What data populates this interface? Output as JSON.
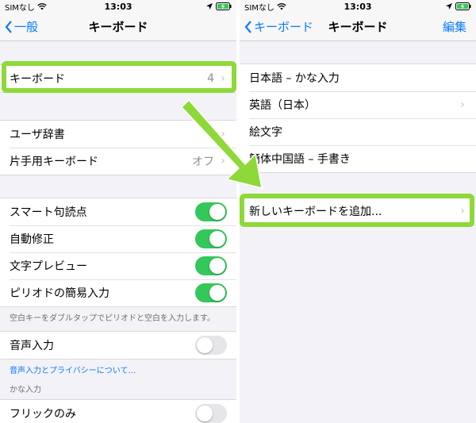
{
  "left": {
    "status": {
      "carrier": "SIMなし",
      "time": "13:03"
    },
    "nav": {
      "back_label": "一般",
      "title": "キーボード"
    },
    "keyboards_row": {
      "label": "キーボード",
      "value": "4"
    },
    "group2": [
      {
        "label": "ユーザ辞書",
        "value": ""
      },
      {
        "label": "片手用キーボード",
        "value": "オフ"
      }
    ],
    "toggles": [
      {
        "label": "スマート句読点",
        "on": true
      },
      {
        "label": "自動修正",
        "on": true
      },
      {
        "label": "文字プレビュー",
        "on": true
      },
      {
        "label": "ピリオドの簡易入力",
        "on": true
      }
    ],
    "period_footnote": "空白キーをダブルタップでピリオドと空白を入力します。",
    "voice": {
      "label": "音声入力",
      "on": false
    },
    "voice_link": "音声入力とプライバシーについて...",
    "kana_header": "かな入力",
    "partial_row": "フリックのみ"
  },
  "right": {
    "status": {
      "carrier": "SIMなし",
      "time": "13:03"
    },
    "nav": {
      "back_label": "キーボード",
      "title": "キーボード",
      "action": "編集"
    },
    "keyboards": [
      {
        "label": "日本語 – かな入力",
        "chevron": false
      },
      {
        "label": "英語（日本）",
        "chevron": true
      },
      {
        "label": "絵文字",
        "chevron": false
      },
      {
        "label": "簡体中国語 – 手書き",
        "chevron": false
      }
    ],
    "add_row": "新しいキーボードを追加..."
  },
  "colors": {
    "accent": "#0a7aff",
    "switch_on": "#34c759",
    "highlight": "#8ed83a"
  }
}
